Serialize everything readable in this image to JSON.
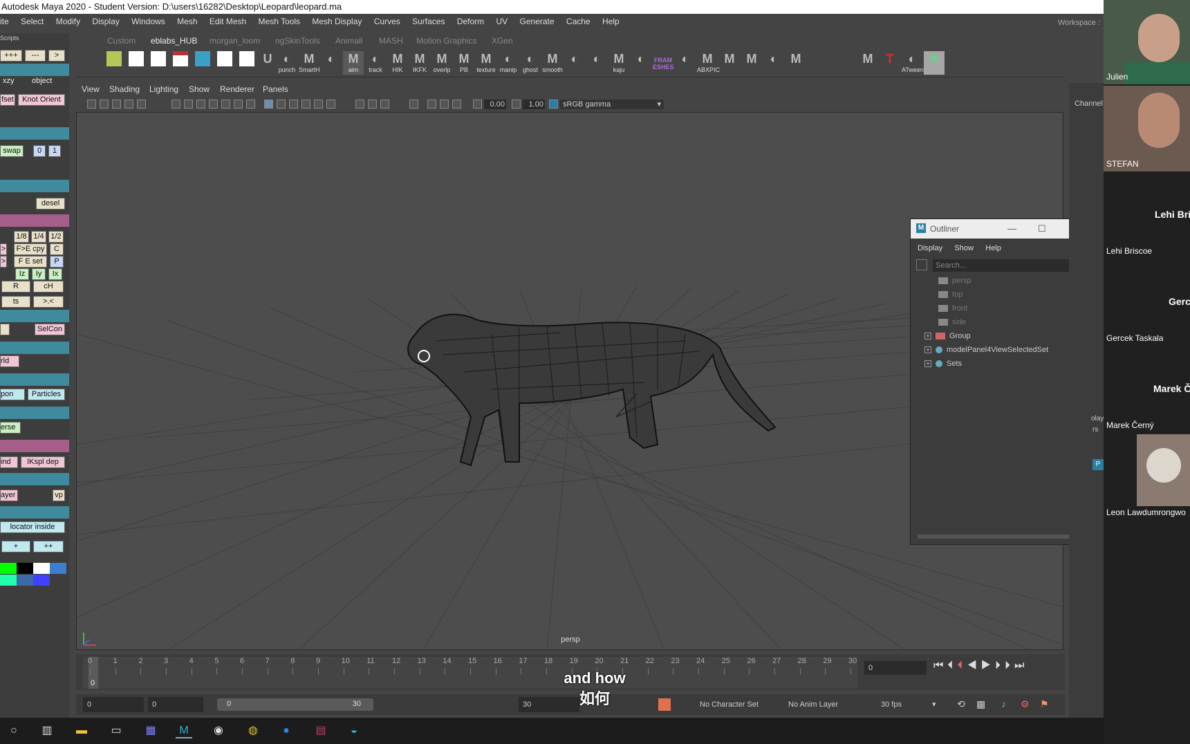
{
  "title": "Autodesk Maya 2020 - Student Version: D:\\users\\16282\\Desktop\\Leopard\\leopard.ma",
  "menus": [
    "ite",
    "Select",
    "Modify",
    "Display",
    "Windows",
    "Mesh",
    "Edit Mesh",
    "Mesh Tools",
    "Mesh Display",
    "Curves",
    "Surfaces",
    "Deform",
    "UV",
    "Generate",
    "Cache",
    "Help"
  ],
  "workspace_label": "Workspace :",
  "left_panel": {
    "header": "Scripts",
    "buttons": [
      "+++",
      "---",
      ">",
      "xzy",
      "object",
      "fset",
      "Knot Orient",
      "swap",
      "0",
      "1",
      "desel",
      "1/8",
      "1/4",
      "1/2",
      ">",
      "F>E cpy",
      "C",
      ">",
      "F E set",
      "P",
      "Iz",
      "Iy",
      "Ix",
      "R",
      "cH",
      "ts",
      ">.<",
      "SelCon",
      "rld",
      "pon",
      "Particles",
      "erse",
      "ind",
      "IKspl dep",
      "ayer",
      "vp",
      "locator inside",
      "+",
      "++"
    ],
    "swatches": [
      "#00ff00",
      "#000000",
      "#ffffff",
      "#3c7fd0",
      "#22ffaa",
      "#3c6aa6",
      "#4040ff"
    ]
  },
  "shelf": {
    "tabs": [
      "Custom",
      "eblabs_HUB",
      "morgan_loom",
      "ngSkinTools",
      "Animall",
      "MASH",
      "Motion Graphics",
      "XGen"
    ],
    "active_tab": "eblabs_HUB",
    "icon_labels": [
      "punch",
      "SmartH",
      "aim",
      "track",
      "HIK",
      "IKFK",
      "overlp",
      "PB",
      "texture",
      "manip",
      "ghost",
      "smooth",
      "kaju",
      "FRAM ESHES",
      "ABXPIC",
      "ATween"
    ]
  },
  "viewport": {
    "menu": [
      "View",
      "Shading",
      "Lighting",
      "Show",
      "Renderer",
      "Panels"
    ],
    "exposure": "0.00",
    "gamma": "1.00",
    "color_space": "sRGB gamma",
    "camera_label": "persp"
  },
  "outliner": {
    "title": "Outliner",
    "menu": [
      "Display",
      "Show",
      "Help"
    ],
    "search_placeholder": "Search...",
    "items": [
      {
        "label": "persp",
        "dim": true,
        "type": "camera"
      },
      {
        "label": "top",
        "dim": true,
        "type": "camera"
      },
      {
        "label": "front",
        "dim": true,
        "type": "camera"
      },
      {
        "label": "side",
        "dim": true,
        "type": "camera"
      },
      {
        "label": "Group",
        "dim": false,
        "type": "group"
      },
      {
        "label": "modelPanel4ViewSelectedSet",
        "dim": false,
        "type": "set"
      },
      {
        "label": "Sets",
        "dim": false,
        "type": "set"
      }
    ]
  },
  "timeline": {
    "ticks": [
      "0",
      "1",
      "2",
      "3",
      "4",
      "5",
      "6",
      "7",
      "8",
      "9",
      "10",
      "11",
      "12",
      "13",
      "14",
      "15",
      "16",
      "17",
      "18",
      "19",
      "20",
      "21",
      "22",
      "23",
      "24",
      "25",
      "26",
      "27",
      "28",
      "29",
      "30"
    ],
    "current_frame": "0",
    "current_frame_field": "0"
  },
  "range": {
    "start": "0",
    "anim_start": "0",
    "slider_start": "0",
    "slider_end": "30",
    "anim_end": "30",
    "character_set": "No Character Set",
    "anim_layer": "No Anim Layer",
    "fps": "30 fps"
  },
  "subtitle": {
    "en": "and how",
    "zh": "如何"
  },
  "channel_box_label": "Channel",
  "channel_box_misc": [
    "olay",
    "rs",
    "P"
  ],
  "participants": [
    {
      "name": "Julien",
      "big": ""
    },
    {
      "name": "STEFAN",
      "big": ""
    },
    {
      "name": "Lehi Briscoe",
      "big": "Lehi Bris"
    },
    {
      "name": "Gercek Taskala",
      "big": "Gercek Ta"
    },
    {
      "name": "Marek Černý",
      "big": "Marek Č"
    },
    {
      "name": "Leon Lawdumrongwo",
      "big": ""
    }
  ],
  "taskbar_icons": [
    "cortana-icon",
    "task-view-icon",
    "file-explorer-icon",
    "media-icon",
    "app-grid-icon",
    "maya-icon",
    "obs-icon",
    "chrome-icon",
    "zoom-icon",
    "winrar-icon",
    "edge-icon"
  ]
}
